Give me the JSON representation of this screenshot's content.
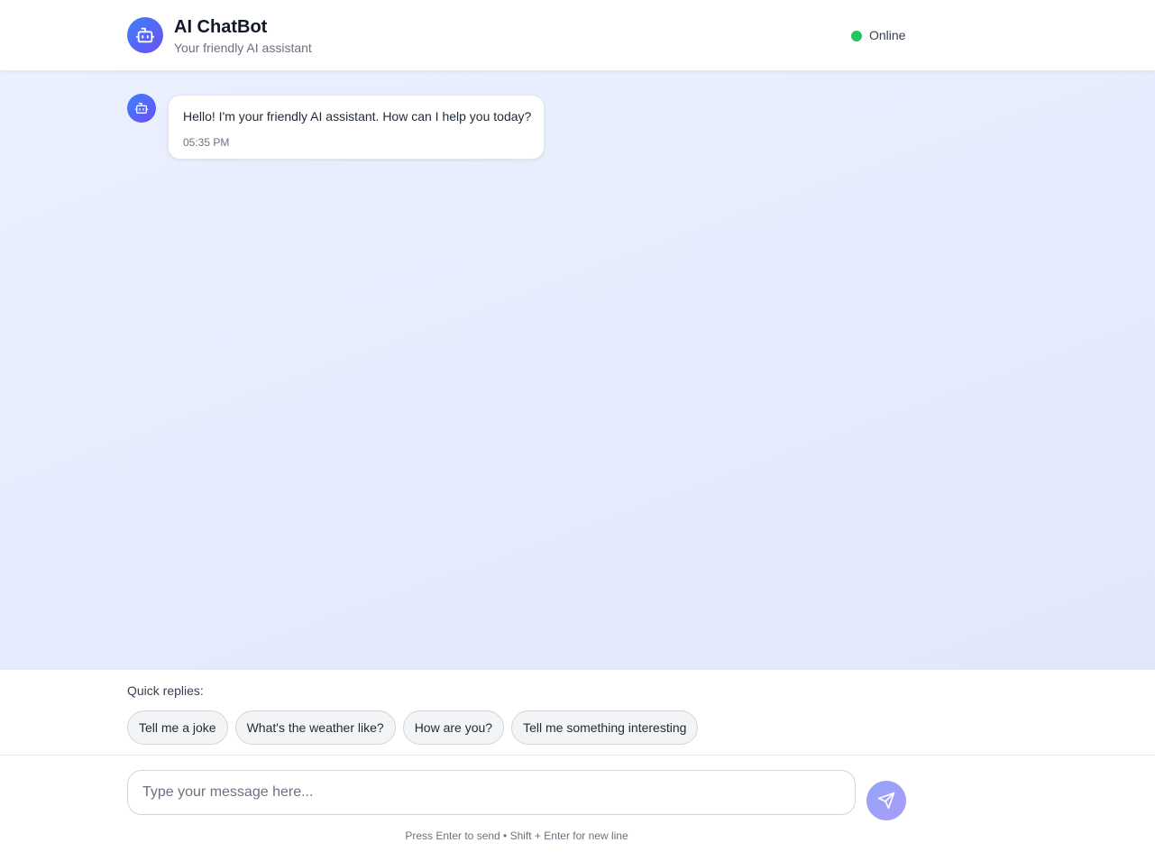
{
  "header": {
    "title": "AI ChatBot",
    "subtitle": "Your friendly AI assistant",
    "avatar_icon": "robot-icon",
    "status": "Online",
    "status_color": "#22c55e",
    "accent_gradient": [
      "#3b82f6",
      "#6d4ef5"
    ]
  },
  "messages": [
    {
      "sender": "bot",
      "avatar_icon": "robot-icon",
      "text": "Hello! I'm your friendly AI assistant. How can I help you today?",
      "time": "05:35 PM"
    }
  ],
  "quick_replies": {
    "label": "Quick replies:",
    "items": [
      "Tell me a joke",
      "What's the weather like?",
      "How are you?",
      "Tell me something interesting"
    ]
  },
  "composer": {
    "placeholder": "Type your message here...",
    "value": "",
    "send_icon": "send-icon",
    "hint": "Press Enter to send • Shift + Enter for new line"
  }
}
